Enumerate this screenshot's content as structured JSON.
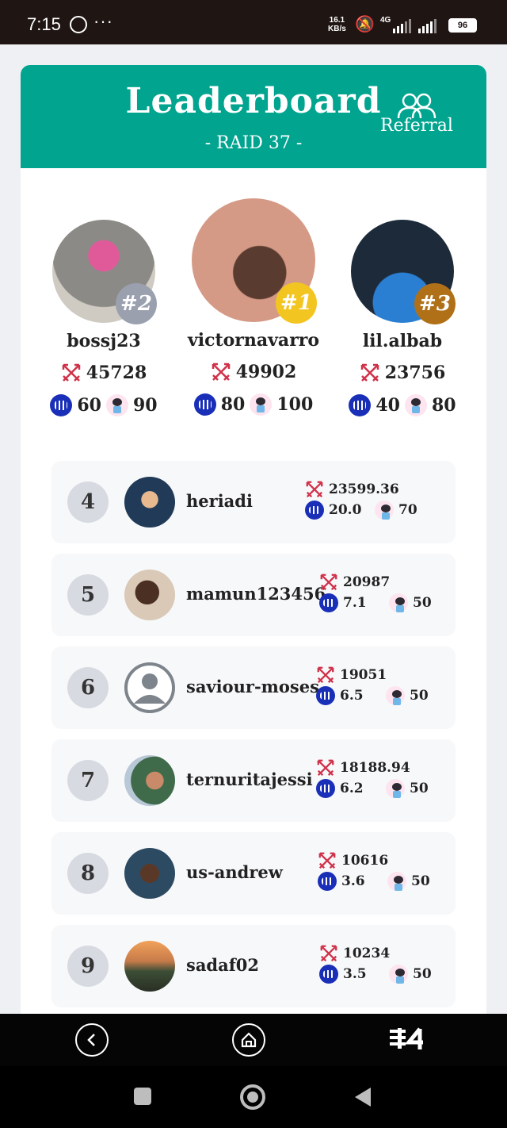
{
  "status_bar": {
    "time": "7:15",
    "speed_value": "16.1",
    "speed_unit": "KB/s",
    "network": "4G",
    "battery": "96"
  },
  "header": {
    "title": "Leaderboard",
    "subtitle": "- RAID 37 -",
    "referral_label": "Referral"
  },
  "podium": [
    {
      "rank": "#2",
      "name": "bossj23",
      "score": "45728",
      "steem": "60",
      "mascot": "90"
    },
    {
      "rank": "#1",
      "name": "victornavarro",
      "score": "49902",
      "steem": "80",
      "mascot": "100"
    },
    {
      "rank": "#3",
      "name": "lil.albab",
      "score": "23756",
      "steem": "40",
      "mascot": "80"
    }
  ],
  "rows": [
    {
      "rank": "4",
      "name": "heriadi",
      "score": "23599.36",
      "steem": "20.0",
      "mascot": "70"
    },
    {
      "rank": "5",
      "name": "mamun123456",
      "score": "20987",
      "steem": "7.1",
      "mascot": "50"
    },
    {
      "rank": "6",
      "name": "saviour-moses",
      "score": "19051",
      "steem": "6.5",
      "mascot": "50"
    },
    {
      "rank": "7",
      "name": "ternuritajessi",
      "score": "18188.94",
      "steem": "6.2",
      "mascot": "50"
    },
    {
      "rank": "8",
      "name": "us-andrew",
      "score": "10616",
      "steem": "3.6",
      "mascot": "50"
    },
    {
      "rank": "9",
      "name": "sadaf02",
      "score": "10234",
      "steem": "3.5",
      "mascot": "50"
    }
  ],
  "colors": {
    "header_bg": "#00a48f",
    "rank1": "#f2c521",
    "rank2": "#9aa0ae",
    "rank3": "#b07018",
    "steem": "#1a2fb8",
    "sword": "#d0324a"
  },
  "icons": {
    "referral": "people-icon",
    "score": "crossed-swords-icon",
    "steem": "steem-token-icon",
    "mascot": "mascot-token-icon"
  }
}
